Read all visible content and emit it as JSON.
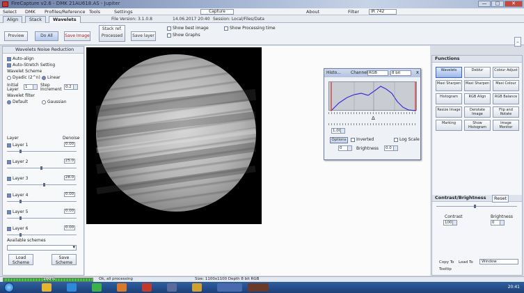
{
  "window": {
    "title": "FireCapture v2.6 - DMK 21AU618.AS - Jupiter",
    "close_label": "✕",
    "min_label": "—",
    "max_label": "□"
  },
  "menu": {
    "items": [
      "Select",
      "DMK",
      "Profiles/Reference",
      "Tools",
      "Settings"
    ],
    "capture_label": "Capture",
    "about_label": "About",
    "filter_label": "IR 742"
  },
  "tabs": {
    "items": [
      "Align",
      "Stack",
      "Wavelets"
    ],
    "file_version": "File Version: 3.1.0.8",
    "session": "14.06.2017 20:40",
    "session_path": "Session: Local/Files/Data"
  },
  "toolbar": {
    "preview": "Preview",
    "do_all": "Do All",
    "save_image": "Save Image",
    "stack_ref": "Stack ref. Processed",
    "save_layer": "Save layer",
    "show_best": "Show best image",
    "show_graph": "Show Graphs",
    "show_pre": "Show Processing time"
  },
  "left": {
    "header": "Wavelets   Noise Reduction",
    "autoalign": "Auto-align",
    "autostretch": "Auto-Stretch Setting",
    "wavelet_scheme": "Wavelet Scheme",
    "dyadic": "Dyadic (2^n)",
    "linear": "Linear",
    "initial_layer": "Initial Layer",
    "step": "Step Increment",
    "initial_val": "1",
    "step_val": "0.2",
    "wavelet_filter": "Wavelet filter",
    "default": "Default",
    "gaussian": "Gaussian",
    "levels_title": "Layer",
    "denoise_title": "Denoise",
    "levels": [
      {
        "label": "Layer 1",
        "value": "0.00"
      },
      {
        "label": "Layer 2",
        "value": "25.0"
      },
      {
        "label": "Layer 3",
        "value": "28.0"
      },
      {
        "label": "Layer 4",
        "value": "0.00"
      },
      {
        "label": "Layer 5",
        "value": "0.00"
      },
      {
        "label": "Layer 6",
        "value": "0.00"
      }
    ],
    "available_schemes": "Available schemes",
    "load_scheme": "Load Scheme",
    "save_scheme": "Save Scheme"
  },
  "histogram": {
    "title": "Histo...",
    "channel_label": "Channel",
    "channel_value": "RGB",
    "bits_value": "8 bit",
    "gamma": "1.00",
    "log_scale": "Log Scale",
    "options": "Options",
    "inverted": "Inverted",
    "brightness_label": "Brightness",
    "brightness_value": "0.0",
    "contrast_value": "0",
    "close": "x",
    "marker": "Δ"
  },
  "right": {
    "functions_header": "Functions",
    "buttons": [
      "Wavelets",
      "Deblur",
      "Colour Adjust",
      "Maxi Sharpen",
      "Maxi Sharpen",
      "Maxi Colour",
      "Histogram",
      "RGB Align",
      "RGB Balance",
      "Resize Image",
      "Derotate Image",
      "Flip and Rotate",
      "Marking",
      "Show Histogram",
      "Image Monitor"
    ],
    "cb_header": "Contrast/Brightness",
    "reset": "Reset",
    "contrast_label": "Contrast",
    "contrast_val": "100",
    "brightness_label": "Brightness",
    "brightness_val": "0",
    "copy_label": "Copy To",
    "load_label": "Load To",
    "target": "Window",
    "tooltip": "Tooltip"
  },
  "status": {
    "progress_label": "100%",
    "text1": "Ok, all processing",
    "text2": "Size: 1100x1100 Depth 8 bit RGB",
    "progress": 1.0
  },
  "taskbar": {
    "time": "20:41"
  },
  "colors": {
    "accent": "#6b89c9",
    "hist_curve": "#3a2fd6",
    "hist_marker": "#d02a2a"
  }
}
